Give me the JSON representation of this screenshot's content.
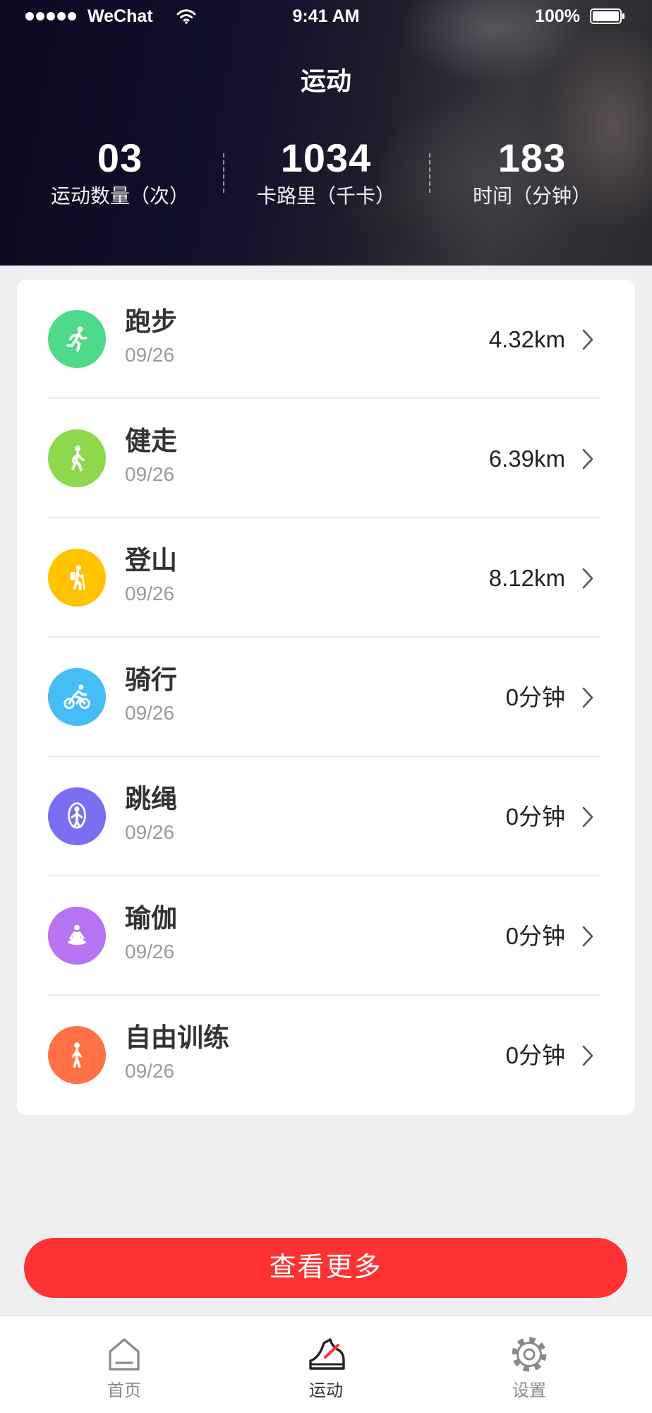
{
  "status_bar": {
    "carrier": "WeChat",
    "time": "9:41 AM",
    "battery": "100%"
  },
  "header": {
    "title": "运动",
    "stats": [
      {
        "value": "03",
        "label": "运动数量（次）"
      },
      {
        "value": "1034",
        "label": "卡路里（千卡）"
      },
      {
        "value": "183",
        "label": "时间（分钟）"
      }
    ]
  },
  "activities": [
    {
      "name": "跑步",
      "date": "09/26",
      "value": "4.32km",
      "icon": "running-icon",
      "color": "#4ed98b"
    },
    {
      "name": "健走",
      "date": "09/26",
      "value": "6.39km",
      "icon": "walking-icon",
      "color": "#8fd84b"
    },
    {
      "name": "登山",
      "date": "09/26",
      "value": "8.12km",
      "icon": "hiking-icon",
      "color": "#ffc300"
    },
    {
      "name": "骑行",
      "date": "09/26",
      "value": "0分钟",
      "icon": "cycling-icon",
      "color": "#45bdf7"
    },
    {
      "name": "跳绳",
      "date": "09/26",
      "value": "0分钟",
      "icon": "jump-rope-icon",
      "color": "#7a6ff0"
    },
    {
      "name": "瑜伽",
      "date": "09/26",
      "value": "0分钟",
      "icon": "yoga-icon",
      "color": "#b673f2"
    },
    {
      "name": "自由训练",
      "date": "09/26",
      "value": "0分钟",
      "icon": "free-training-icon",
      "color": "#ff7045"
    }
  ],
  "more_button": {
    "label": "查看更多"
  },
  "tab_bar": {
    "items": [
      {
        "label": "首页",
        "icon": "home-icon",
        "active": false
      },
      {
        "label": "运动",
        "icon": "sneaker-icon",
        "active": true
      },
      {
        "label": "设置",
        "icon": "gear-icon",
        "active": false
      }
    ]
  },
  "colors": {
    "accent": "#fe3232",
    "page_background": "#efeff2",
    "header_background": "#12102b",
    "text_primary": "#333333",
    "text_secondary": "#9a9a9a"
  }
}
